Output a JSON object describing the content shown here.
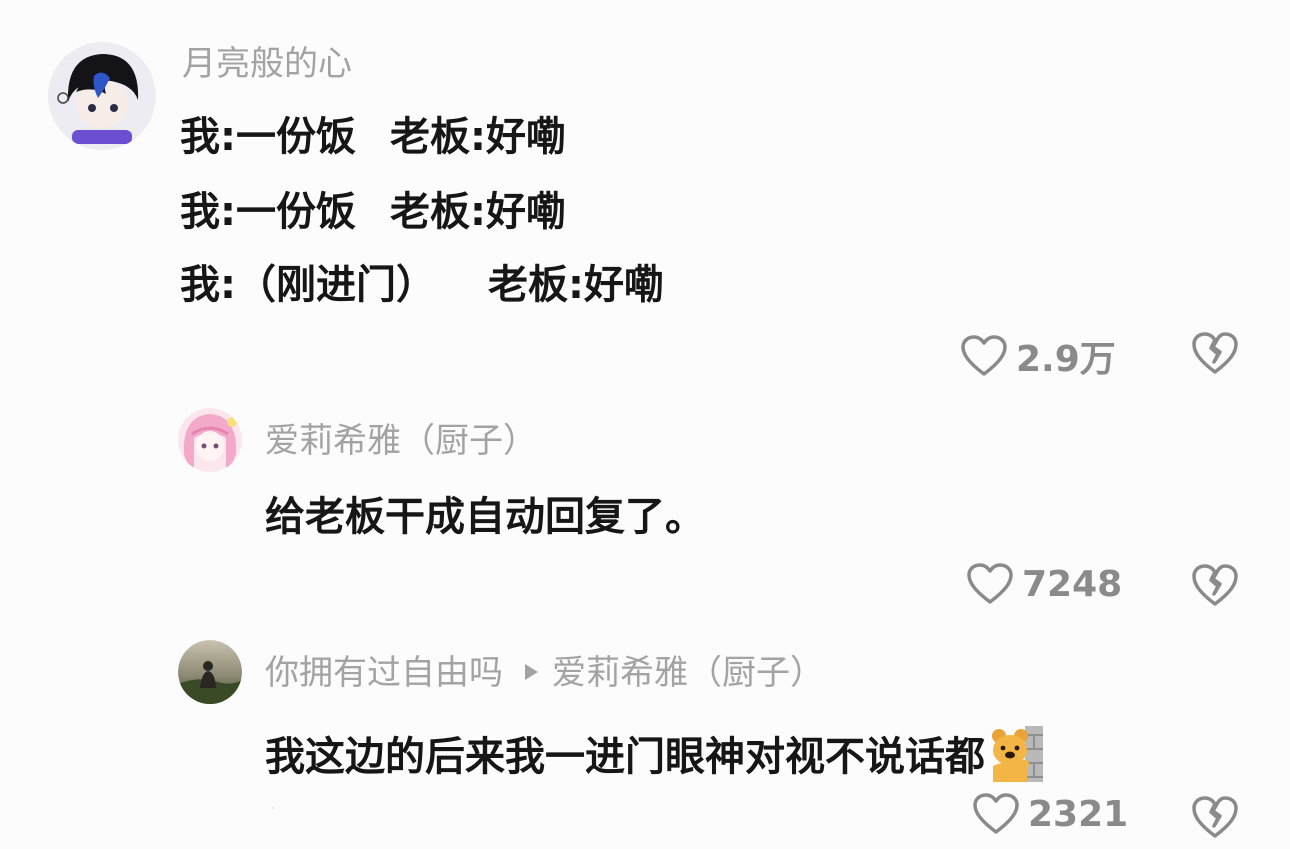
{
  "comment": {
    "username": "月亮般的心",
    "lines": [
      {
        "me": "我:一份饭",
        "boss": "老板:好嘞"
      },
      {
        "me": "我:一份饭",
        "boss": "老板:好嘞"
      },
      {
        "me": "我:（刚进门）",
        "boss": "老板:好嘞"
      }
    ],
    "likes": "2.9万"
  },
  "replies": [
    {
      "username": "爱莉希雅（厨子）",
      "text": "给老板干成自动回复了。",
      "likes": "7248"
    },
    {
      "username": "你拥有过自由吗",
      "reply_to": "爱莉希雅（厨子）",
      "text": "我这边的后来我一进门眼神对视不说话都",
      "likes": "2321"
    }
  ],
  "icons": {
    "like": "heart-outline-icon",
    "dislike": "broken-heart-icon",
    "reply_arrow": "triangle-right-icon",
    "emoji": "bear-peeking-wall-emoji"
  },
  "colors": {
    "background": "#fcfcfc",
    "text": "#161616",
    "muted": "#a3a3a3",
    "icon": "#8a8a8a"
  }
}
